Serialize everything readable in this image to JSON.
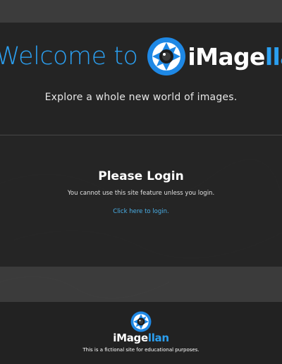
{
  "hero": {
    "welcome": "Welcome to",
    "brand_white": "iMage",
    "brand_blue": "llan",
    "tagline": "Explore a whole new world of images."
  },
  "login": {
    "title": "Please Login",
    "message": "You cannot use this site feature unless you login.",
    "link": "Click here to login."
  },
  "footer": {
    "brand_white": "iMage",
    "brand_blue": "llan",
    "note": "This is a fictional site for educational purposes."
  },
  "colors": {
    "accent": "#2b9ff0",
    "link": "#4ab0e8",
    "dark_bg": "#242424"
  },
  "icons": [
    "camera-lens-logo-icon"
  ]
}
